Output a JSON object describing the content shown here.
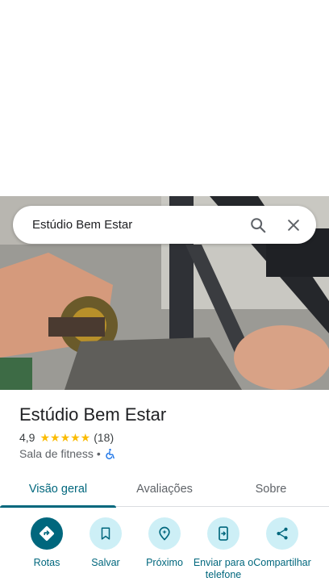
{
  "search": {
    "query": "Estúdio Bem Estar"
  },
  "place": {
    "name": "Estúdio Bem Estar",
    "rating": "4,9",
    "stars": "★★★★★",
    "review_count": "(18)",
    "category": "Sala de fitness",
    "separator": "•",
    "accessibility_icon": "wheelchair-icon"
  },
  "tabs": [
    {
      "label": "Visão geral",
      "active": true
    },
    {
      "label": "Avaliações",
      "active": false
    },
    {
      "label": "Sobre",
      "active": false
    }
  ],
  "actions": [
    {
      "label": "Rotas",
      "icon": "directions-icon"
    },
    {
      "label": "Salvar",
      "icon": "bookmark-icon"
    },
    {
      "label": "Próximo",
      "icon": "nearby-icon"
    },
    {
      "label": "Enviar para o telefone",
      "icon": "send-to-phone-icon"
    },
    {
      "label": "Compartilhar",
      "icon": "share-icon"
    }
  ],
  "colors": {
    "accent": "#00677d",
    "accent_light": "#cdeff6",
    "star": "#fbbc04"
  }
}
